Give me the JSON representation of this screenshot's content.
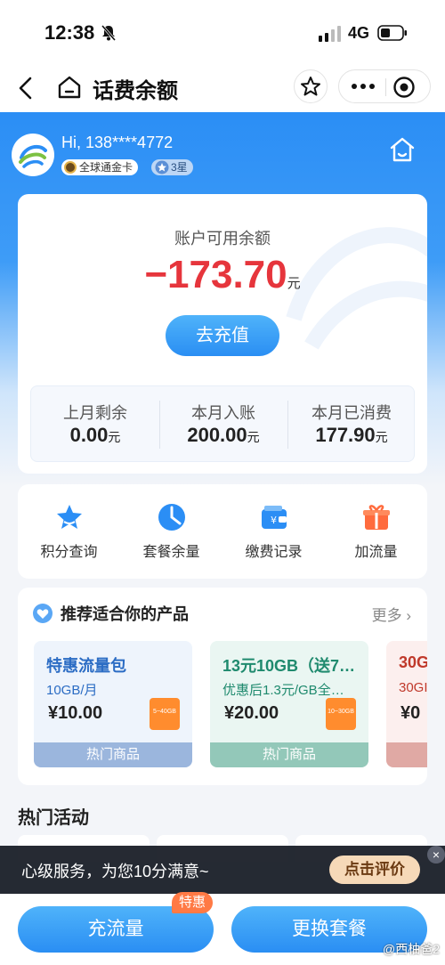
{
  "status_bar": {
    "time": "12:38",
    "network": "4G"
  },
  "nav": {
    "title": "话费余额"
  },
  "header": {
    "greeting": "Hi, 138****4772",
    "card_badge": "全球通金卡",
    "star_badge": "3星"
  },
  "balance": {
    "label": "账户可用余额",
    "amount": "−173.70",
    "unit": "元",
    "recharge_label": "去充值",
    "stats": [
      {
        "label": "上月剩余",
        "value": "0.00",
        "unit": "元"
      },
      {
        "label": "本月入账",
        "value": "200.00",
        "unit": "元"
      },
      {
        "label": "本月已消费",
        "value": "177.90",
        "unit": "元"
      }
    ]
  },
  "quick_menu": [
    {
      "label": "积分查询",
      "icon": "star-icon"
    },
    {
      "label": "套餐余量",
      "icon": "pie-chart-icon"
    },
    {
      "label": "缴费记录",
      "icon": "wallet-icon"
    },
    {
      "label": "加流量",
      "icon": "gift-icon"
    }
  ],
  "recommend": {
    "title": "推荐适合你的产品",
    "more": "更多",
    "products": [
      {
        "name": "特惠流量包",
        "desc": "10GB/月",
        "price": "¥10.00",
        "tag": "热门商品",
        "box": "5~40GB",
        "color": "#2b6cc4",
        "tag_bg": "#9bb6dd",
        "bg": "#eef4fc"
      },
      {
        "name": "13元10GB（送7…",
        "desc": "优惠后1.3元/GB全…",
        "price": "¥20.00",
        "tag": "热门商品",
        "box": "10~30GB",
        "color": "#1f8a6e",
        "tag_bg": "#93c8b9",
        "bg": "#eaf6f2"
      },
      {
        "name": "30G",
        "desc": "30GI",
        "price": "¥0",
        "tag": "",
        "box": "",
        "color": "#c0392b",
        "tag_bg": "#e0a9a4",
        "bg": "#fcefee"
      }
    ]
  },
  "hot": {
    "title": "热门活动"
  },
  "banner": {
    "text": "心级服务，为您10分满意~",
    "button": "点击评价",
    "close": "×"
  },
  "bottom": {
    "left_label": "充流量",
    "badge": "特惠",
    "right_label": "更换套餐"
  },
  "watermark": "@西柚爸2",
  "colors": {
    "primary": "#2b8ef5",
    "negative": "#e6353c",
    "accent": "#ff7a45"
  }
}
